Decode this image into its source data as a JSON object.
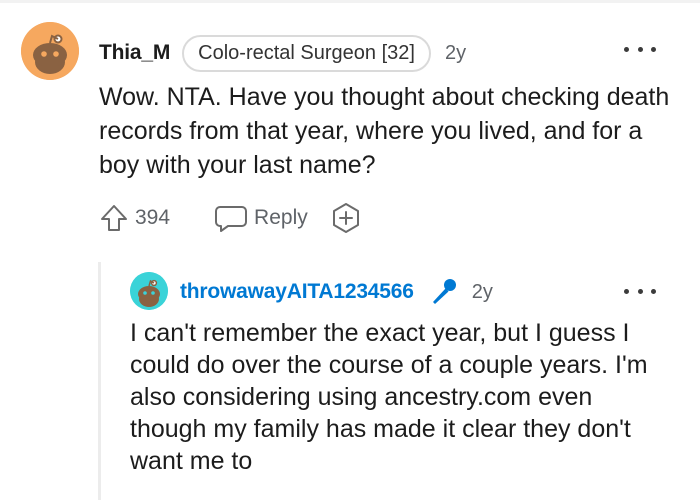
{
  "comment": {
    "username": "Thia_M",
    "flair": "Colo-rectal Surgeon [32]",
    "age": "2y",
    "body": "Wow. NTA. Have you thought about checking death records from that year, where you lived, and for a boy with your last name?",
    "score": "394",
    "reply_label": "Reply",
    "icons": {
      "avatar": "snoo-avatar-orange",
      "upvote": "upvote-arrow-icon",
      "reply": "speech-bubble-icon",
      "award": "award-plus-icon",
      "more": "more-dots-icon"
    }
  },
  "reply": {
    "username": "throwawayAITA1234566",
    "age": "2y",
    "body": "I can't remember the exact year, but I guess I could do over the course of a couple years. I'm also considering using ancestry.com even though my family has made it clear they don't want me to",
    "icons": {
      "avatar": "snoo-avatar-teal",
      "op_badge": "microphone-icon",
      "more": "more-dots-icon"
    }
  },
  "colors": {
    "avatar_orange": "#f6a85f",
    "avatar_teal": "#3ad3d8",
    "op_username": "#0079d3",
    "meta_gray": "#5f6368"
  }
}
